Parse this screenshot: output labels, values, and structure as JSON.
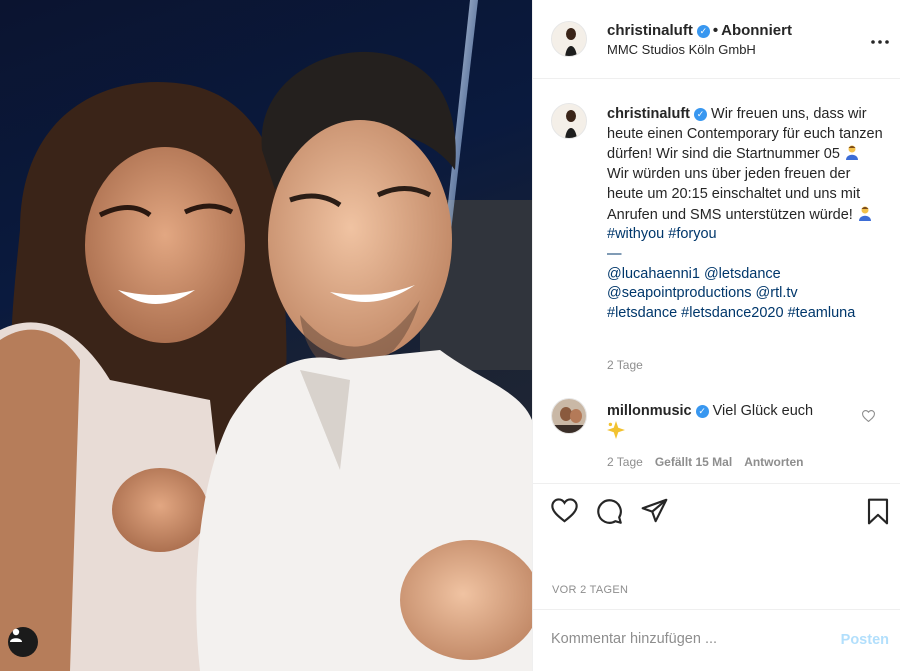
{
  "post": {
    "author": "christinaluft",
    "follow_state": "Abonniert",
    "separator": "•",
    "location": "MMC Studios Köln GmbH",
    "more_glyph": "•••"
  },
  "caption": {
    "author": "christinaluft",
    "text_1": "Wir freuen uns, dass wir heute einen Contemporary für euch tanzen dürfen! Wir sind die Startnummer 05",
    "text_2": "Wir würden uns über jeden freuen der heute um 20:15 einschaltet und uns mit Anrufen und SMS unterstützen würde!",
    "hashtags": "#withyou #foryou",
    "dash": "—",
    "mentions_1": "@lucahaenni1 @letsdance",
    "mentions_2": "@seapointproductions @rtl.tv",
    "hashtags_2": "#letsdance #letsdance2020 #teamluna",
    "time": "2 Tage"
  },
  "comment": {
    "author": "millonmusic",
    "text": "Viel Glück euch",
    "time": "2 Tage",
    "likes": "Gefällt 15 Mal",
    "reply": "Antworten"
  },
  "meta": {
    "posted_ago": "VOR 2 TAGEN"
  },
  "add_comment": {
    "placeholder": "Kommentar hinzufügen ...",
    "post_label": "Posten"
  },
  "colors": {
    "link": "#00376b",
    "verified": "#3897f0",
    "muted": "#8e8e8e",
    "post_disabled": "#b2dffc"
  },
  "icons": [
    "verified-icon",
    "more-icon",
    "heart-icon",
    "comment-icon",
    "share-icon",
    "bookmark-icon",
    "user-tag-icon",
    "sparkle-icon",
    "person-emoji-icon"
  ]
}
